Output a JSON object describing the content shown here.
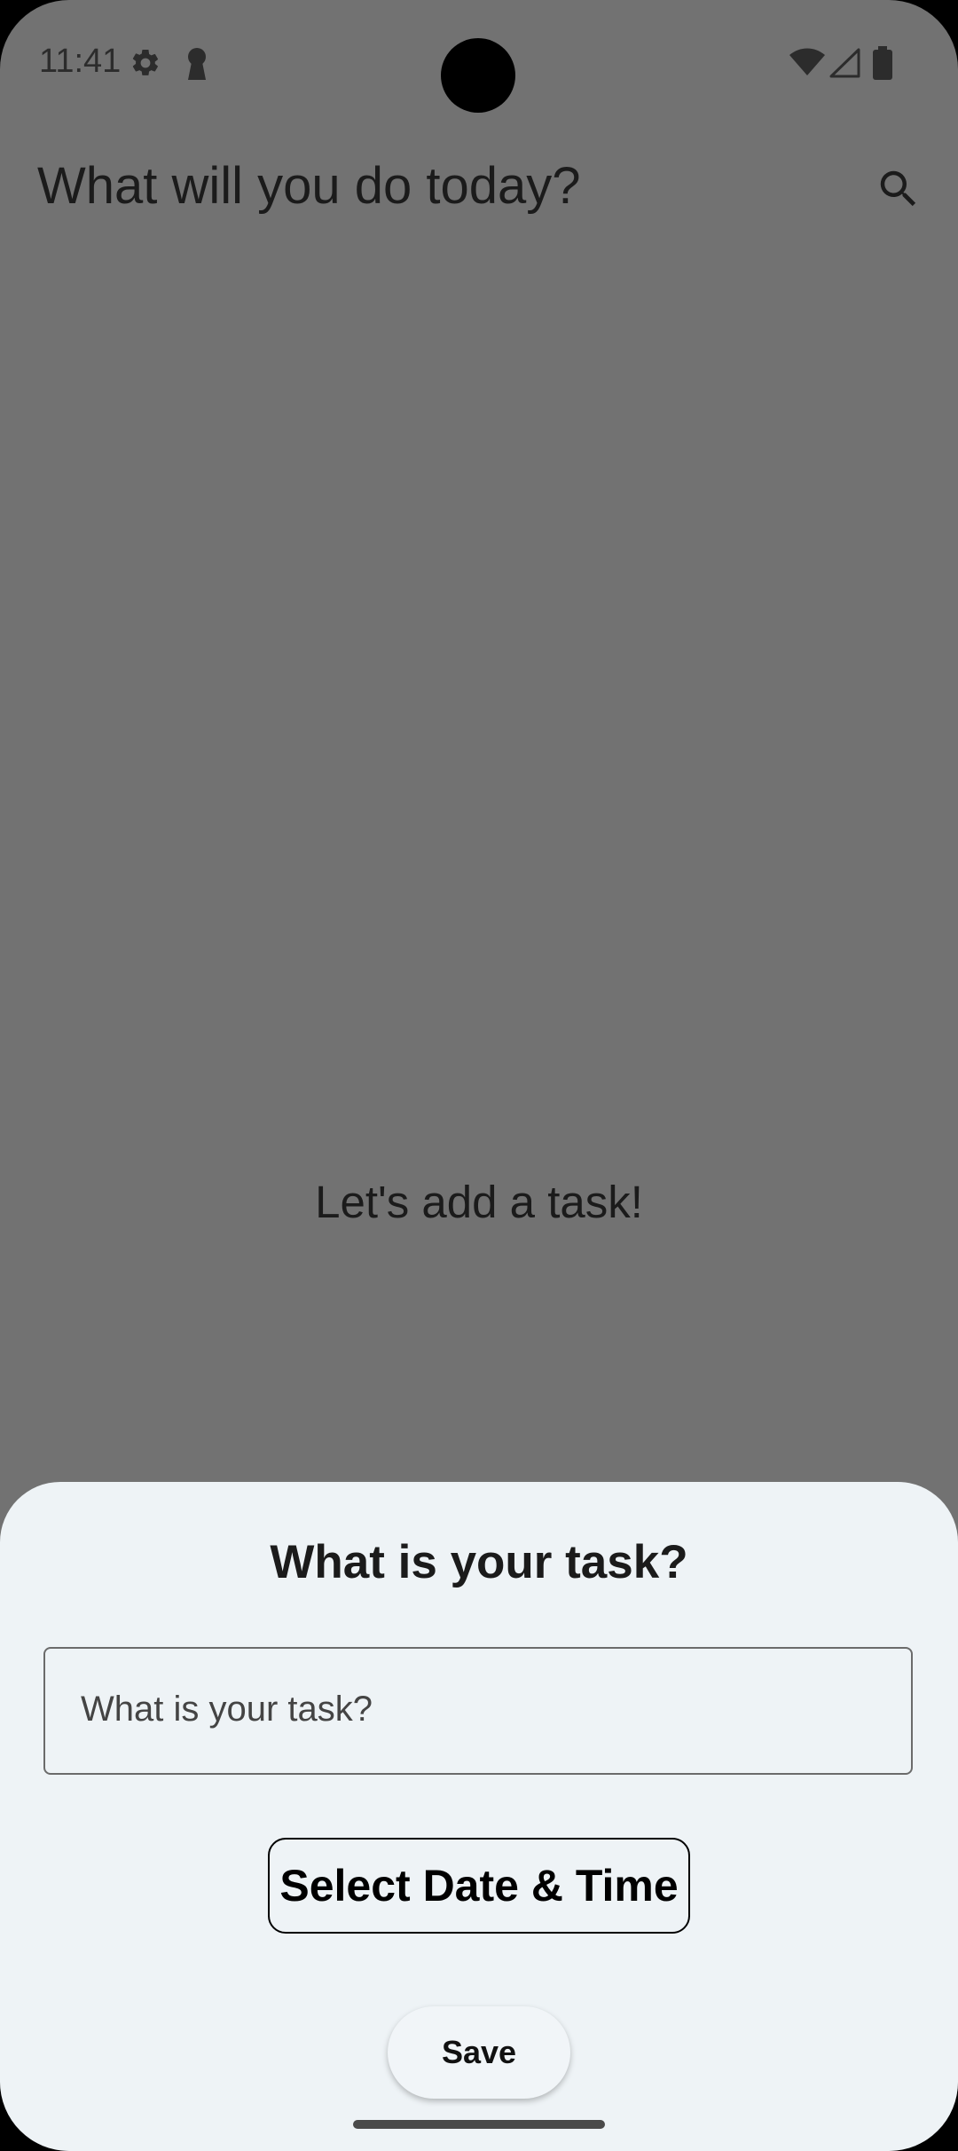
{
  "status_bar": {
    "time": "11:41",
    "icons": [
      "gear-icon",
      "keyhole-icon",
      "wifi-icon",
      "signal-icon",
      "battery-icon"
    ]
  },
  "app_bar": {
    "title": "What will you do today?",
    "search_icon": "search-icon"
  },
  "main": {
    "empty_message": "Let's add a task!"
  },
  "sheet": {
    "title": "What is your task?",
    "task_input_placeholder": "What is your task?",
    "task_input_value": "",
    "select_datetime_label": "Select Date & Time",
    "save_label": "Save"
  },
  "colors": {
    "scrim": "#727272",
    "sheet_background": "#eef3f6",
    "text_primary": "#1b1b1b"
  }
}
